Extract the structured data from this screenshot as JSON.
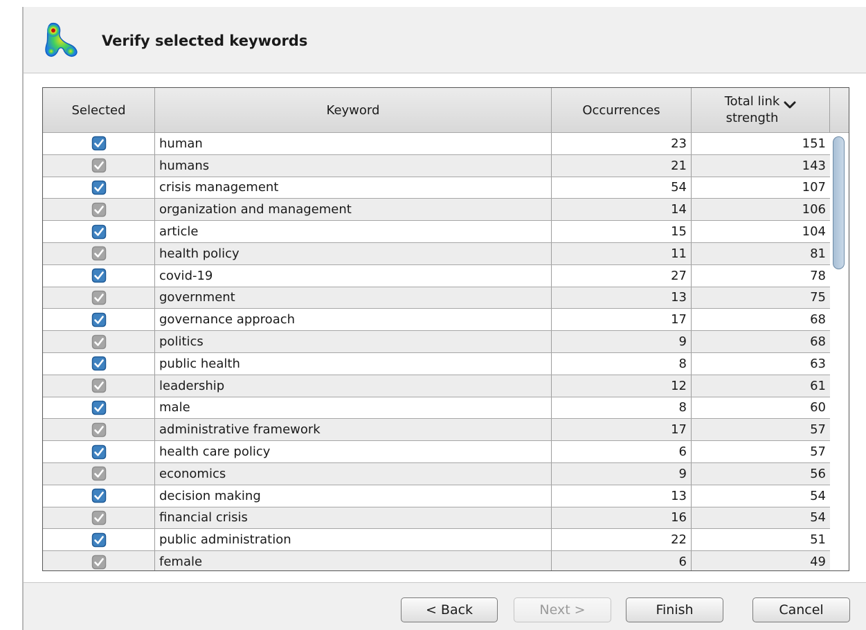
{
  "header": {
    "title": "Verify selected keywords",
    "logo_icon": "vosviewer-density-logo"
  },
  "table": {
    "columns": {
      "selected": "Selected",
      "keyword": "Keyword",
      "occurrences": "Occurrences",
      "total_link_strength": "Total link strength"
    },
    "sort": {
      "column": "total_link_strength",
      "direction": "descending",
      "icon": "chevron-down-icon"
    },
    "rows": [
      {
        "selected": true,
        "keyword": "human",
        "occurrences": "23",
        "total_link_strength": "151"
      },
      {
        "selected": true,
        "keyword": "humans",
        "occurrences": "21",
        "total_link_strength": "143"
      },
      {
        "selected": true,
        "keyword": "crisis management",
        "occurrences": "54",
        "total_link_strength": "107"
      },
      {
        "selected": true,
        "keyword": "organization and management",
        "occurrences": "14",
        "total_link_strength": "106"
      },
      {
        "selected": true,
        "keyword": "article",
        "occurrences": "15",
        "total_link_strength": "104"
      },
      {
        "selected": true,
        "keyword": "health policy",
        "occurrences": "11",
        "total_link_strength": "81"
      },
      {
        "selected": true,
        "keyword": "covid-19",
        "occurrences": "27",
        "total_link_strength": "78"
      },
      {
        "selected": true,
        "keyword": "government",
        "occurrences": "13",
        "total_link_strength": "75"
      },
      {
        "selected": true,
        "keyword": "governance approach",
        "occurrences": "17",
        "total_link_strength": "68"
      },
      {
        "selected": true,
        "keyword": "politics",
        "occurrences": "9",
        "total_link_strength": "68"
      },
      {
        "selected": true,
        "keyword": "public health",
        "occurrences": "8",
        "total_link_strength": "63"
      },
      {
        "selected": true,
        "keyword": "leadership",
        "occurrences": "12",
        "total_link_strength": "61"
      },
      {
        "selected": true,
        "keyword": "male",
        "occurrences": "8",
        "total_link_strength": "60"
      },
      {
        "selected": true,
        "keyword": "administrative framework",
        "occurrences": "17",
        "total_link_strength": "57"
      },
      {
        "selected": true,
        "keyword": "health care policy",
        "occurrences": "6",
        "total_link_strength": "57"
      },
      {
        "selected": true,
        "keyword": "economics",
        "occurrences": "9",
        "total_link_strength": "56"
      },
      {
        "selected": true,
        "keyword": "decision making",
        "occurrences": "13",
        "total_link_strength": "54"
      },
      {
        "selected": true,
        "keyword": "financial crisis",
        "occurrences": "16",
        "total_link_strength": "54"
      },
      {
        "selected": true,
        "keyword": "public administration",
        "occurrences": "22",
        "total_link_strength": "51"
      },
      {
        "selected": true,
        "keyword": "female",
        "occurrences": "6",
        "total_link_strength": "49"
      }
    ]
  },
  "footer": {
    "back_label": "< Back",
    "next_label": "Next >",
    "next_enabled": false,
    "finish_label": "Finish",
    "cancel_label": "Cancel"
  },
  "colors": {
    "checkbox_active": "#3f82c0",
    "checkbox_muted": "#a6a6a6",
    "row_alt": "#ededed",
    "scroll_thumb": "#b7cbe0"
  }
}
